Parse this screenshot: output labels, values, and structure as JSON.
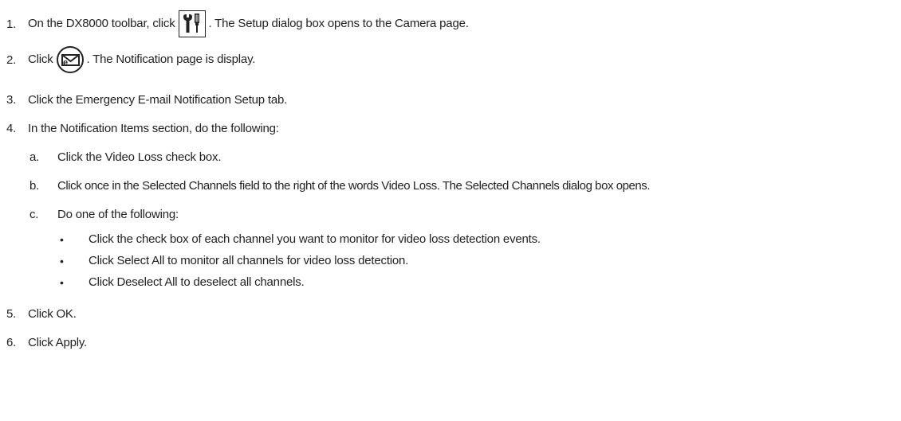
{
  "steps": [
    {
      "num": "1.",
      "pre": "On the DX8000 toolbar, click",
      "post": ". The Setup dialog box opens to the Camera page.",
      "icon": "tools-icon"
    },
    {
      "num": "2.",
      "pre": "Click",
      "post": ". The Notification page is display.",
      "icon": "email-notification-icon"
    },
    {
      "num": "3.",
      "text": "Click the Emergency E-mail Notification Setup tab."
    },
    {
      "num": "4.",
      "text": "In the Notification Items section, do the following:"
    },
    {
      "num": "5.",
      "text": "Click OK."
    },
    {
      "num": "6.",
      "text": "Click Apply."
    }
  ],
  "substeps": [
    {
      "letter": "a.",
      "text": "Click the Video Loss check box."
    },
    {
      "letter": "b.",
      "text": "Click once in the Selected Channels field to the right of the words Video Loss. The Selected Channels dialog box opens."
    },
    {
      "letter": "c.",
      "text": "Do one of the following:"
    }
  ],
  "bullets": [
    {
      "mark": "•",
      "text": "Click the check box of each channel you want to monitor for video loss detection events."
    },
    {
      "mark": "•",
      "text": "Click Select All to monitor all channels for video loss detection."
    },
    {
      "mark": "•",
      "text": "Click Deselect All to deselect all channels."
    }
  ]
}
